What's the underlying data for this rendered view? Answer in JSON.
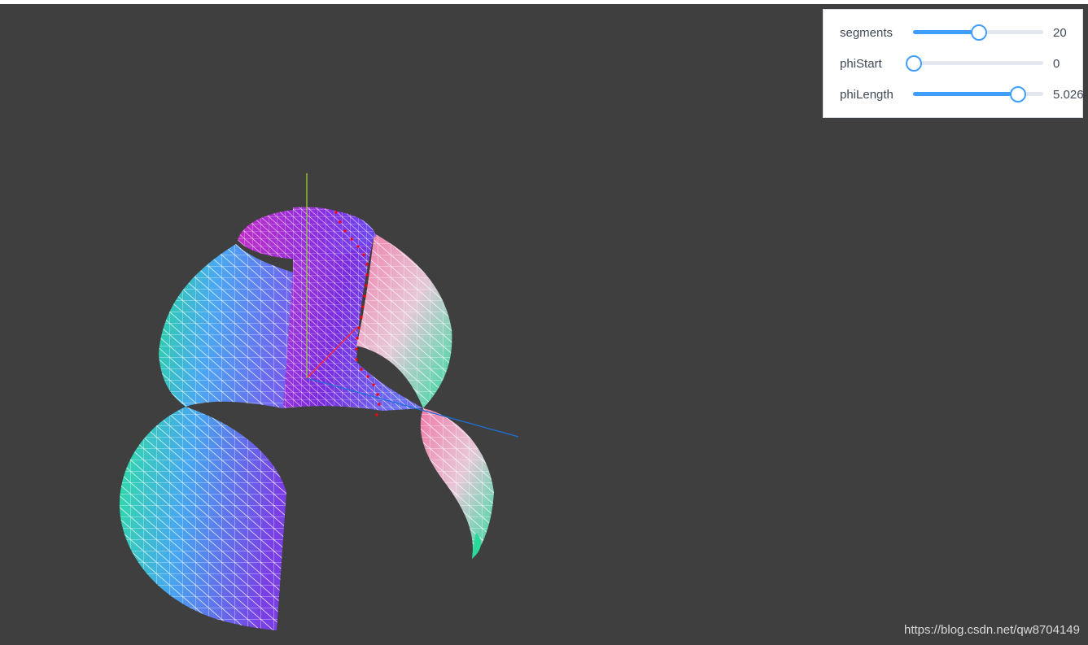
{
  "scene": {
    "background": "#3f3f3f",
    "axis_colors": {
      "x": "#ff2a2a",
      "y": "#9acd32",
      "z": "#1f6fd6"
    },
    "profile_color": "#ff0000",
    "wire_color": "#ffffff",
    "surface_palette": [
      "#26d99a",
      "#4aa8f2",
      "#6a6ef0",
      "#7a2be0",
      "#b43bd6",
      "#f07aa8",
      "#f3eeb0"
    ]
  },
  "controls": {
    "segments": {
      "label": "segments",
      "value": "20",
      "fraction": 0.5
    },
    "phiStart": {
      "label": "phiStart",
      "value": "0",
      "fraction": 0
    },
    "phiLength": {
      "label": "phiLength",
      "value": "5.026",
      "fraction": 0.8
    }
  },
  "accent_color": "#409eff",
  "watermark": "https://blog.csdn.net/qw8704149"
}
